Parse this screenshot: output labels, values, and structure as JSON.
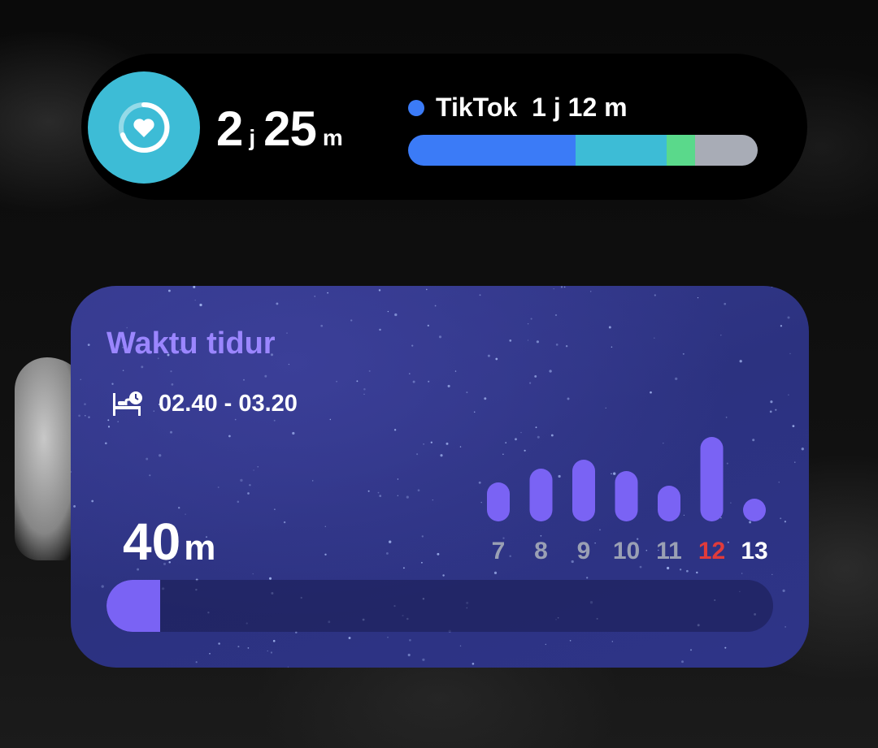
{
  "usage_widget": {
    "total_hours": "2",
    "hours_unit": "j",
    "total_minutes": "25",
    "minutes_unit": "m",
    "top_app": {
      "name": "TikTok",
      "time": "1 j 12 m",
      "dot_color": "#3b7bf7"
    },
    "usage_segments": [
      {
        "color": "#3b7bf7",
        "fraction": 0.48
      },
      {
        "color": "#3dbcd6",
        "fraction": 0.26
      },
      {
        "color": "#5ad98b",
        "fraction": 0.08
      },
      {
        "color": "#a8acb6",
        "fraction": 0.18
      }
    ],
    "icon": "heart-ring-icon",
    "icon_bg_color": "#3dbcd6"
  },
  "sleep_widget": {
    "title": "Waktu tidur",
    "time_range": "02.40 - 03.20",
    "bed_icon": "bed-clock-icon",
    "duration_value": "40",
    "duration_unit": "m",
    "progress_fraction": 0.08,
    "accent_color": "#7a63f4",
    "title_color": "#9b86ff"
  },
  "chart_data": {
    "type": "bar",
    "categories": [
      "7",
      "8",
      "9",
      "10",
      "11",
      "12",
      "13"
    ],
    "values": [
      48,
      65,
      76,
      62,
      44,
      104,
      24
    ],
    "label_colors": [
      "#9aa0b4",
      "#9aa0b4",
      "#9aa0b4",
      "#9aa0b4",
      "#9aa0b4",
      "#e03b3b",
      "#ffffff"
    ],
    "bar_color": "#7a63f4",
    "title": "",
    "xlabel": "",
    "ylabel": ""
  }
}
